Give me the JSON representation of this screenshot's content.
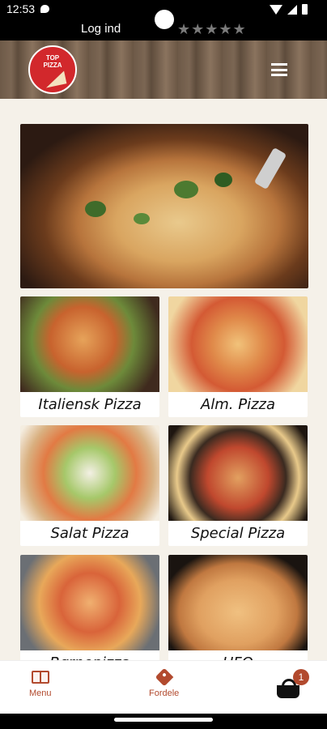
{
  "status_bar": {
    "time": "12:53"
  },
  "title_bar": {
    "login": "Log ind",
    "rating_stars": "★★★★★"
  },
  "header": {
    "logo_text": "TOP\nPIZZA"
  },
  "categories": [
    {
      "label": "Italiensk Pizza"
    },
    {
      "label": "Alm. Pizza"
    },
    {
      "label": "Salat Pizza"
    },
    {
      "label": "Special Pizza"
    },
    {
      "label": "Børnepizza"
    },
    {
      "label": "UFO"
    }
  ],
  "bottom_nav": {
    "menu_label": "Menu",
    "offers_label": "Fordele",
    "cart_count": "1"
  },
  "colors": {
    "accent": "#b24a2e",
    "logo_red": "#d2282c",
    "content_bg": "#f5f1e9"
  }
}
